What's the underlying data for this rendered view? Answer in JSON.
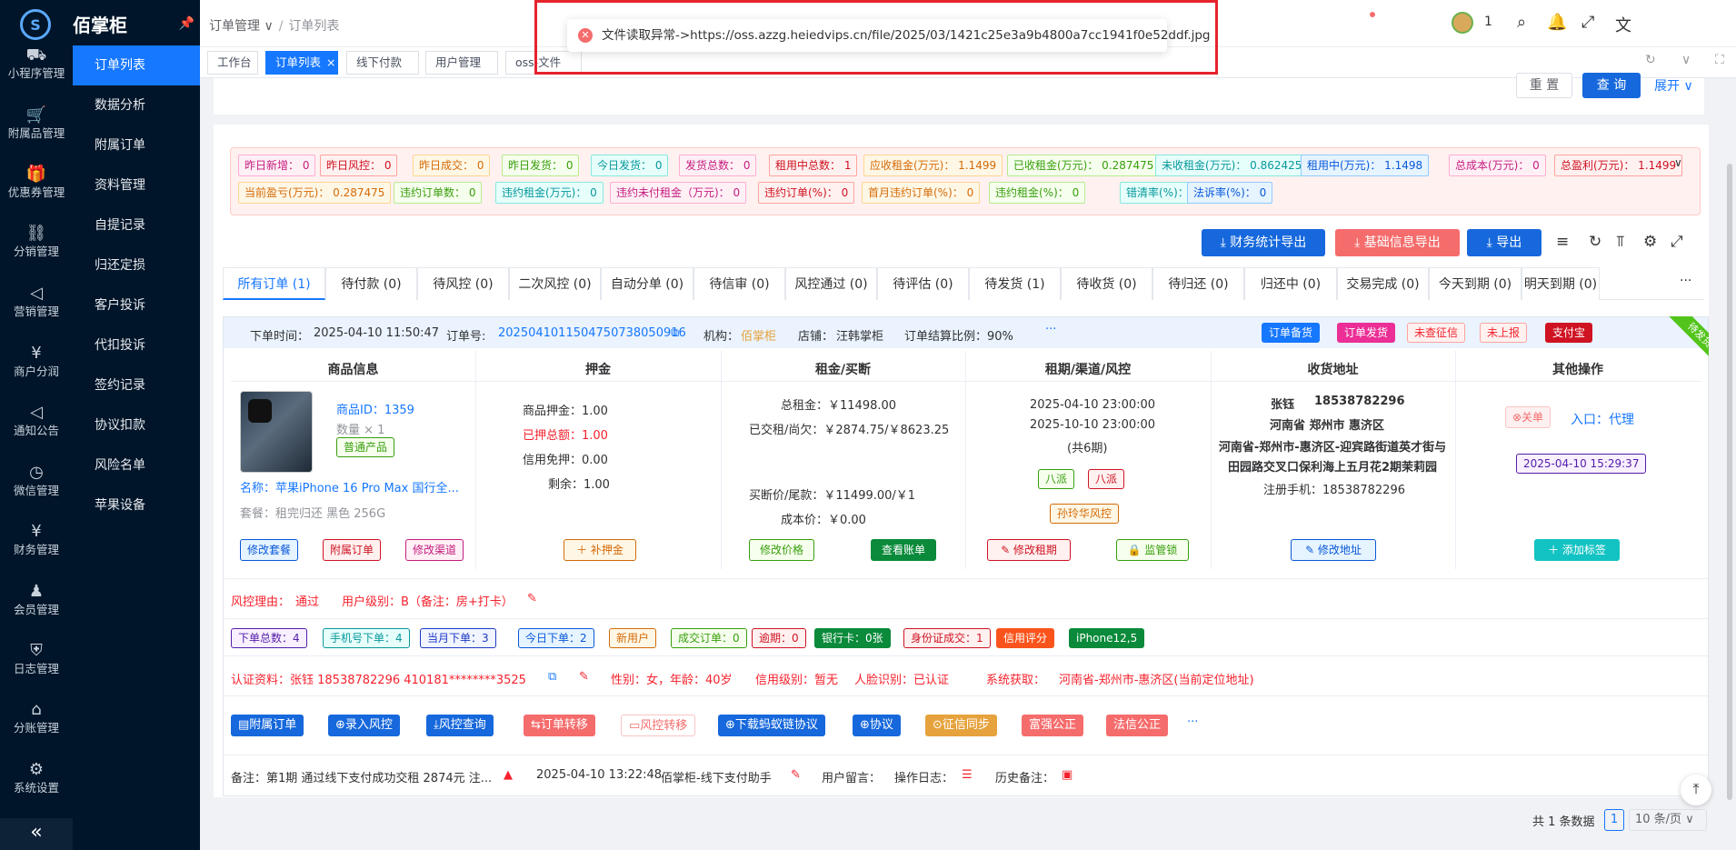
{
  "app": {
    "brand": "佰掌柜",
    "user_name": "1"
  },
  "rail": [
    {
      "icon": "⛟",
      "label": "小程序管理"
    },
    {
      "icon": "🛒",
      "label": "附属品管理"
    },
    {
      "icon": "🎁",
      "label": "优惠券管理"
    },
    {
      "icon": "⛓",
      "label": "分销管理"
    },
    {
      "icon": "◁",
      "label": "营销管理"
    },
    {
      "icon": "¥",
      "label": "商户分润"
    },
    {
      "icon": "◁",
      "label": "通知公告"
    },
    {
      "icon": "◷",
      "label": "微信管理"
    },
    {
      "icon": "¥",
      "label": "财务管理"
    },
    {
      "icon": "♟",
      "label": "会员管理"
    },
    {
      "icon": "⛨",
      "label": "日志管理"
    },
    {
      "icon": "⌂",
      "label": "分账管理"
    },
    {
      "icon": "⚙",
      "label": "系统设置"
    }
  ],
  "sub_menu": [
    "订单列表",
    "数据分析",
    "附属订单",
    "资料管理",
    "自提记录",
    "归还定损",
    "客户投诉",
    "代扣投诉",
    "签约记录",
    "协议扣款",
    "风险名单",
    "苹果设备"
  ],
  "breadcrumb": {
    "parent": "订单管理",
    "current": "订单列表"
  },
  "page_tabs": [
    "工作台",
    "订单列表",
    "线下付款",
    "用户管理",
    "oss-文件"
  ],
  "toast": {
    "message": "文件读取异常->https://oss.azzg.heiedvips.cn/file/2025/03/1421c25e3a9b4800a7cc1941f0e52ddf.jpg"
  },
  "filter": {
    "reset": "重 置",
    "search": "查 询",
    "expand": "展开"
  },
  "stats_row1": [
    {
      "text": "昨日新增： 0",
      "color": "pink"
    },
    {
      "text": "昨日风控： 0",
      "color": "red"
    },
    {
      "text": "昨日成交： 0",
      "color": "orange"
    },
    {
      "text": "昨日发货： 0",
      "color": "green"
    },
    {
      "text": "今日发货： 0",
      "color": "cyan"
    },
    {
      "text": "发货总数： 0",
      "color": "pink"
    },
    {
      "text": "租用中总数： 1",
      "color": "red"
    },
    {
      "text": "应收租金(万元)： 1.1499",
      "color": "orange"
    },
    {
      "text": "已收租金(万元)： 0.287475",
      "color": "green"
    },
    {
      "text": "未收租金(万元)： 0.862425",
      "color": "cyan"
    },
    {
      "text": "租用中(万元)： 1.1498",
      "color": "blue"
    },
    {
      "text": "总成本(万元)： 0",
      "color": "pink"
    },
    {
      "text": "总盈利(万元)： 1.1499",
      "color": "red"
    }
  ],
  "stats_row2": [
    {
      "text": "当前盈亏(万元)： 0.287475",
      "color": "orange"
    },
    {
      "text": "违约订单数： 0",
      "color": "green"
    },
    {
      "text": "违约租金(万元)： 0",
      "color": "cyan"
    },
    {
      "text": "违约未付租金（万元)： 0",
      "color": "pink"
    },
    {
      "text": "违约订单(%)： 0",
      "color": "red"
    },
    {
      "text": "首月违约订单(%)： 0",
      "color": "orange"
    },
    {
      "text": "违约租金(%)： 0",
      "color": "green"
    },
    {
      "text": "错清率(%)： 0",
      "color": "cyan"
    },
    {
      "text": "法诉率(%)： 0",
      "color": "blue"
    }
  ],
  "function_buttons": [
    {
      "label": "⤓ 财务统计导出",
      "color": "#1668dc"
    },
    {
      "label": "⤓ 基础信息导出",
      "color": "#f56c6c"
    },
    {
      "label": "⤓ 导出",
      "color": "#1668dc"
    }
  ],
  "order_tabs": [
    "所有订单 (1)",
    "待付款 (0)",
    "待风控 (0)",
    "二次风控 (0)",
    "自动分单 (0)",
    "待信审 (0)",
    "风控通过 (0)",
    "待评估 (0)",
    "待发货 (1)",
    "待收货 (0)",
    "待归还 (0)",
    "归还中 (0)",
    "交易完成 (0)",
    "今天到期 (0)",
    "明天到期 (0)"
  ],
  "order": {
    "time_label": "下单时间：",
    "time": "2025-04-10 11:50:47",
    "no_label": "订单号:",
    "no": "2025041011504750738050916",
    "org_label": "机构：",
    "org": "佰掌柜",
    "shop_label": "店铺：",
    "shop": "汪韩掌柜",
    "ratio": "订单结算比例：90%",
    "more": "···",
    "status_tags": [
      {
        "text": "订单备货",
        "style": "blue"
      },
      {
        "text": "订单发货",
        "style": "pinkfill"
      },
      {
        "text": "未查征信",
        "style": "redo"
      },
      {
        "text": "未上报",
        "style": "redo"
      },
      {
        "text": "支付宝",
        "style": "redfill"
      }
    ],
    "ribbon": "待发货",
    "columns": [
      "商品信息",
      "押金",
      "租金/买断",
      "租期/渠道/风控",
      "收货地址",
      "其他操作"
    ],
    "product": {
      "id_text": "商品ID：1359",
      "qty": "数量 × 1",
      "kind": "普通产品",
      "name": "名称：苹果iPhone 16 Pro Max 国行全...",
      "package": "套餐：租完归还 黑色 256G",
      "actions": [
        "修改套餐",
        "附属订单",
        "修改渠道"
      ]
    },
    "deposit": {
      "goods": "商品押金：1.00",
      "paid": "已押总额：1.00",
      "credit": "信用免押：0.00",
      "rest": "剩余：1.00",
      "action": "＋ 补押金"
    },
    "rent": {
      "total": "总租金：￥11498.00",
      "paid": "已交租/尚欠：￥2874.75/￥8623.25",
      "buyout": "买断价/尾款：￥11499.00/￥1",
      "cost": "成本价：￥0.00",
      "actions": [
        "修改价格",
        "查看账单"
      ]
    },
    "period": {
      "start": "2025-04-10 23:00:00",
      "end": "2025-10-10 23:00:00",
      "count": "(共6期)",
      "channels": [
        "八派",
        "八派"
      ],
      "risk": "孙玲华风控",
      "actions": [
        "✎ 修改租期",
        "🔒 监管锁"
      ]
    },
    "address": {
      "name": "张钰",
      "phone": "18538782296",
      "line1": "河南省 郑州市 惠济区",
      "line2": "河南省-郑州市-惠济区-迎宾路街道英才街与",
      "line3": "田园路交叉口保利海上五月花2期茉莉园",
      "reg": "注册手机：18538782296",
      "action": "✎ 修改地址"
    },
    "other": {
      "close": "⊗关单",
      "entry": "入口：代理",
      "time": "2025-04-10 15:29:37",
      "add_tag": "＋ 添加标签"
    },
    "risk_line": {
      "reason_label": "风控理由：",
      "reason": "通过",
      "level": "用户级别：B（备注：房+打卡）"
    },
    "user_tags": [
      {
        "text": "下单总数：4",
        "color": "purple"
      },
      {
        "text": "手机号下单：4",
        "color": "cyan"
      },
      {
        "text": "当月下单：3",
        "color": "geek"
      },
      {
        "text": "今日下单：2",
        "color": "blue"
      },
      {
        "text": "新用户",
        "color": "orange"
      },
      {
        "text": "成交订单：0",
        "color": "green"
      },
      {
        "text": "逾期：0",
        "color": "red"
      },
      {
        "text": "银行卡：0张",
        "color": "greenfill"
      },
      {
        "text": "身份证成交：1",
        "color": "red"
      },
      {
        "text": "信用评分",
        "color": "orangefill"
      },
      {
        "text": "iPhone12,5",
        "color": "greenfill"
      }
    ],
    "cert": {
      "text": "认证资料：张钰   18538782296   410181********3525",
      "gender": "性别：女，年龄：40岁",
      "credit": "信用级别：暂无",
      "face": "人脸识别：已认证",
      "sys": "系统获取：",
      "loc": "河南省-郑州市-惠济区(当前定位地址)"
    },
    "action_buttons": [
      {
        "label": "▤附属订单",
        "color": "#1668dc"
      },
      {
        "label": "⊕录入风控",
        "color": "#1668dc"
      },
      {
        "label": "⤓风控查询",
        "color": "#1668dc"
      },
      {
        "label": "⇆订单转移",
        "color": "#f56c6c"
      },
      {
        "label": "▭风控转移",
        "color": "#fbc4c4"
      },
      {
        "label": "⊕下载蚂蚁链协议",
        "color": "#1668dc"
      },
      {
        "label": "⊕协议",
        "color": "#1668dc"
      },
      {
        "label": "⊙征信同步",
        "color": "#e6a23c"
      },
      {
        "label": "富强公正",
        "color": "#f56c6c"
      },
      {
        "label": "法信公正",
        "color": "#f56c6c"
      }
    ],
    "remark": {
      "text": "备注：第1期 通过线下支付成功交租 2874元 注...",
      "time": "2025-04-10 13:22:48",
      "by": "佰掌柜-线下支付助手",
      "msg": "用户留言：",
      "log": "操作日志：",
      "history": "历史备注："
    }
  },
  "pagination": {
    "total": "共 1 条数据",
    "page": "1",
    "size": "10 条/页"
  }
}
